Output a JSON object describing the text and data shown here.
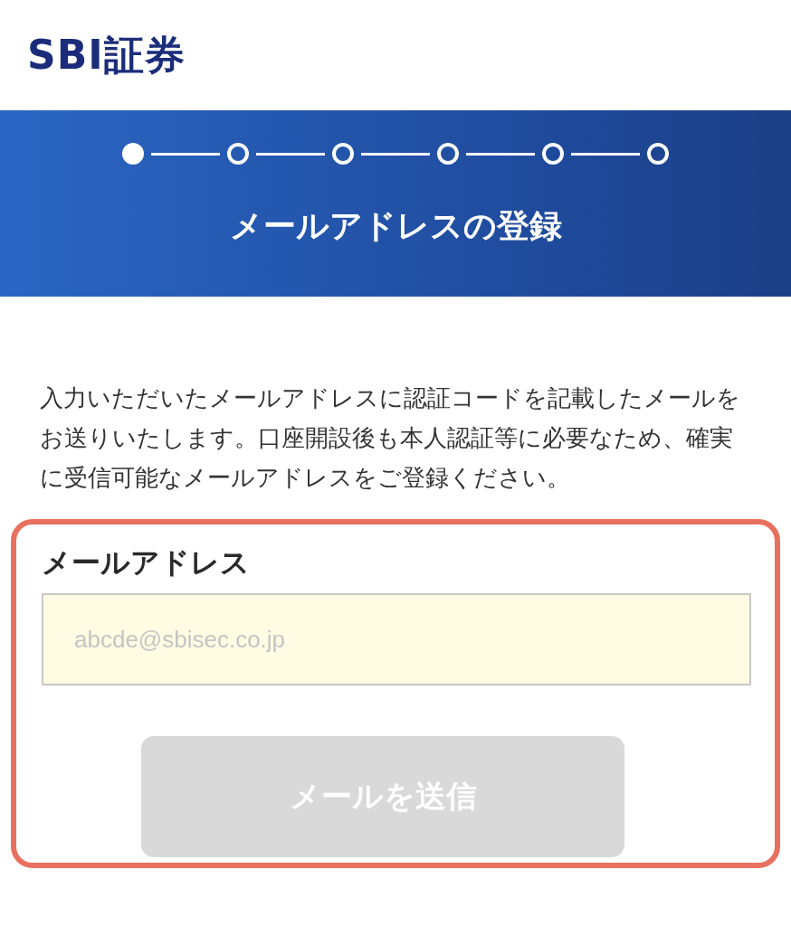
{
  "logo": {
    "text": "SBI証券"
  },
  "header": {
    "steps": [
      {
        "selected": true
      },
      {
        "selected": false
      },
      {
        "selected": false
      },
      {
        "selected": false
      },
      {
        "selected": false
      },
      {
        "selected": false
      }
    ],
    "title": "メールアドレスの登録"
  },
  "description": "入力いただいたメールアドレスに認証コードを記載したメールをお送りいたします。口座開設後も本人認証等に必要なため、確実に受信可能なメールアドレスをご登録ください。",
  "form": {
    "highlighted": true,
    "label": "メールアドレス",
    "email": {
      "placeholder": "abcde@sbisec.co.jp"
    },
    "submit": {
      "label": "メールを送信",
      "disabled": true
    }
  }
}
